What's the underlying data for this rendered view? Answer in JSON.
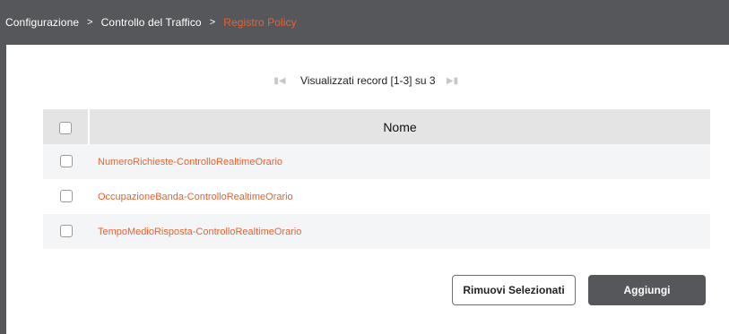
{
  "breadcrumb": {
    "items": [
      "Configurazione",
      "Controllo del Traffico",
      "Registro Policy"
    ],
    "separator": ">"
  },
  "pager": {
    "text": "Visualizzati record [1-3] su 3",
    "first_icon": "first-page-icon",
    "last_icon": "last-page-icon"
  },
  "table": {
    "column_header": "Nome",
    "rows": [
      "NumeroRichieste-ControlloRealtimeOrario",
      "OccupazioneBanda-ControlloRealtimeOrario",
      "TempoMedioRisposta-ControlloRealtimeOrario"
    ]
  },
  "actions": {
    "remove_label": "Rimuovi Selezionati",
    "add_label": "Aggiungi"
  },
  "colors": {
    "header_bg": "#56575b",
    "accent": "#e8622c",
    "table_header_bg": "#e4e4e4",
    "row_stripe": "#f4f5f7"
  }
}
